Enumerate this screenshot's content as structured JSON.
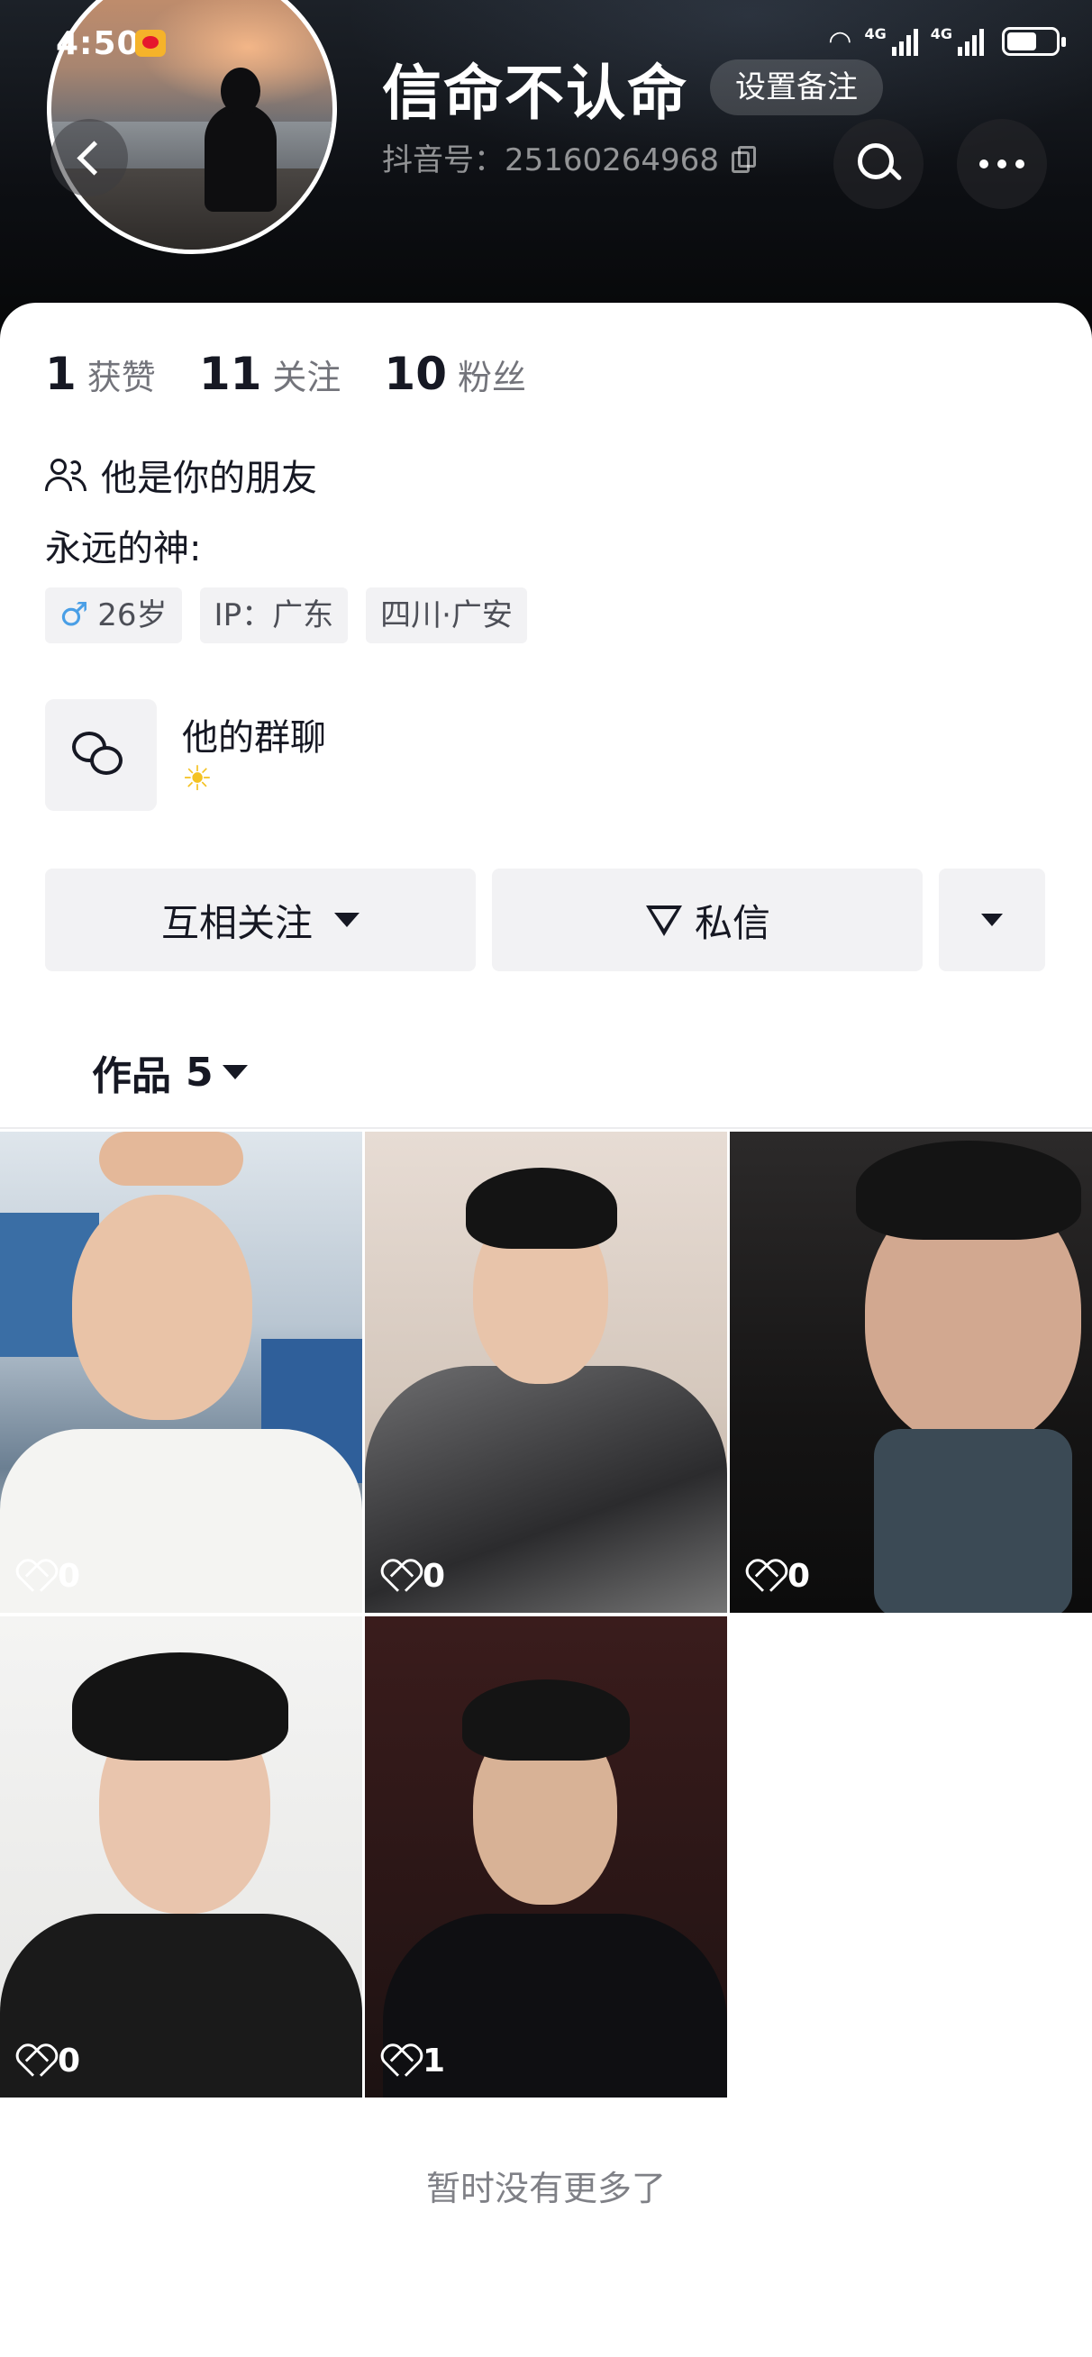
{
  "status_bar": {
    "time": "4:50",
    "network_label": "4G"
  },
  "profile": {
    "nickname": "信命不认命",
    "set_remark_label": "设置备注",
    "douyin_id": "抖音号：25160264968"
  },
  "stats": [
    {
      "value": "1",
      "label": "获赞"
    },
    {
      "value": "11",
      "label": "关注"
    },
    {
      "value": "10",
      "label": "粉丝"
    }
  ],
  "friend_status": "他是你的朋友",
  "bio": "永远的神:",
  "tags": {
    "gender_symbol": "♂",
    "age": "26岁",
    "ip": "IP：广东",
    "location": "四川·广安"
  },
  "group": {
    "title": "他的群聊",
    "emoji": "☀"
  },
  "actions": {
    "follow_label": "互相关注",
    "message_label": "私信"
  },
  "works_tab": {
    "label": "作品",
    "count": "5"
  },
  "videos": [
    {
      "likes": "0"
    },
    {
      "likes": "0"
    },
    {
      "likes": "0"
    },
    {
      "likes": "0"
    },
    {
      "likes": "1"
    }
  ],
  "footer": "暂时没有更多了",
  "colors": {
    "accent_text": "#161823",
    "tag_bg": "#f2f2f4",
    "male_icon": "#4a9fe6"
  }
}
